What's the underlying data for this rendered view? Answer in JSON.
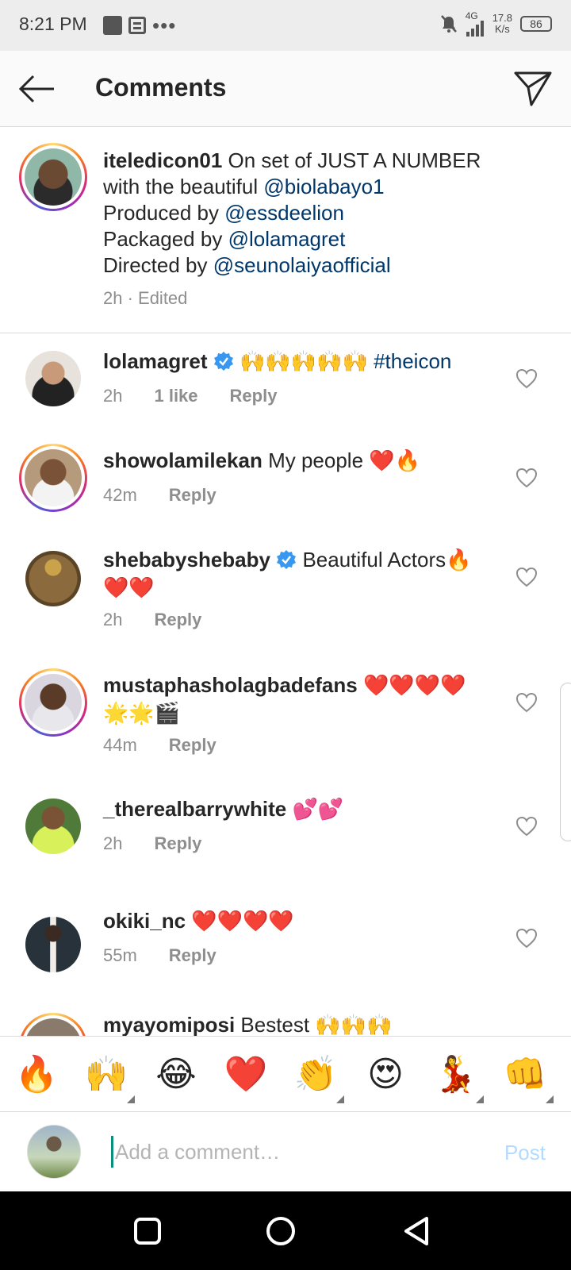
{
  "status": {
    "time": "8:21 PM",
    "net_type": "4G",
    "net_speed_value": "17.8",
    "net_speed_unit": "K/s",
    "battery": "86"
  },
  "header": {
    "title": "Comments"
  },
  "caption": {
    "username": "iteledicon01",
    "text_1": "On set of JUST A NUMBER with the beautiful",
    "mention_1": "@biolabayo1",
    "produced_prefix": "Produced by",
    "mention_2": "@essdeelion",
    "packaged_prefix": "Packaged by",
    "mention_3": "@lolamagret",
    "directed_prefix": "Directed by",
    "mention_4": "@seunolaiyaofficial",
    "meta": "2h · Edited"
  },
  "comments": [
    {
      "username": "lolamagret",
      "emoji": "🙌🙌🙌🙌🙌",
      "hashtag": "#theicon",
      "time": "2h",
      "likes": "1 like",
      "reply": "Reply"
    },
    {
      "username": "showolamilekan",
      "text": "My people",
      "emoji": "❤️🔥",
      "time": "42m",
      "reply": "Reply"
    },
    {
      "username": "shebabyshebaby",
      "text": "Beautiful Actors",
      "emoji_a": "🔥",
      "emoji_b": "❤️❤️",
      "time": "2h",
      "reply": "Reply"
    },
    {
      "username": "mustaphasholagbadefans",
      "emoji_a": "❤️❤️❤️❤️",
      "emoji_b": "🌟🌟🎬",
      "time": "44m",
      "reply": "Reply"
    },
    {
      "username": "_therealbarrywhite",
      "emoji": "💕💕",
      "time": "2h",
      "reply": "Reply"
    },
    {
      "username": "okiki_nc",
      "emoji": "❤️❤️❤️❤️",
      "time": "55m",
      "reply": "Reply"
    },
    {
      "username": "myayomiposi",
      "text": "Bestest",
      "emoji": "🙌🙌🙌"
    }
  ],
  "quick_emojis": [
    "🔥",
    "🙌",
    "😂",
    "❤️",
    "👏",
    "😍",
    "💃",
    "👊"
  ],
  "composer": {
    "placeholder": "Add a comment…",
    "post_label": "Post"
  },
  "colors": {
    "link": "#00376b",
    "muted": "#8e8e8e",
    "verified": "#3897f0",
    "post_disabled": "#b3dbff"
  }
}
